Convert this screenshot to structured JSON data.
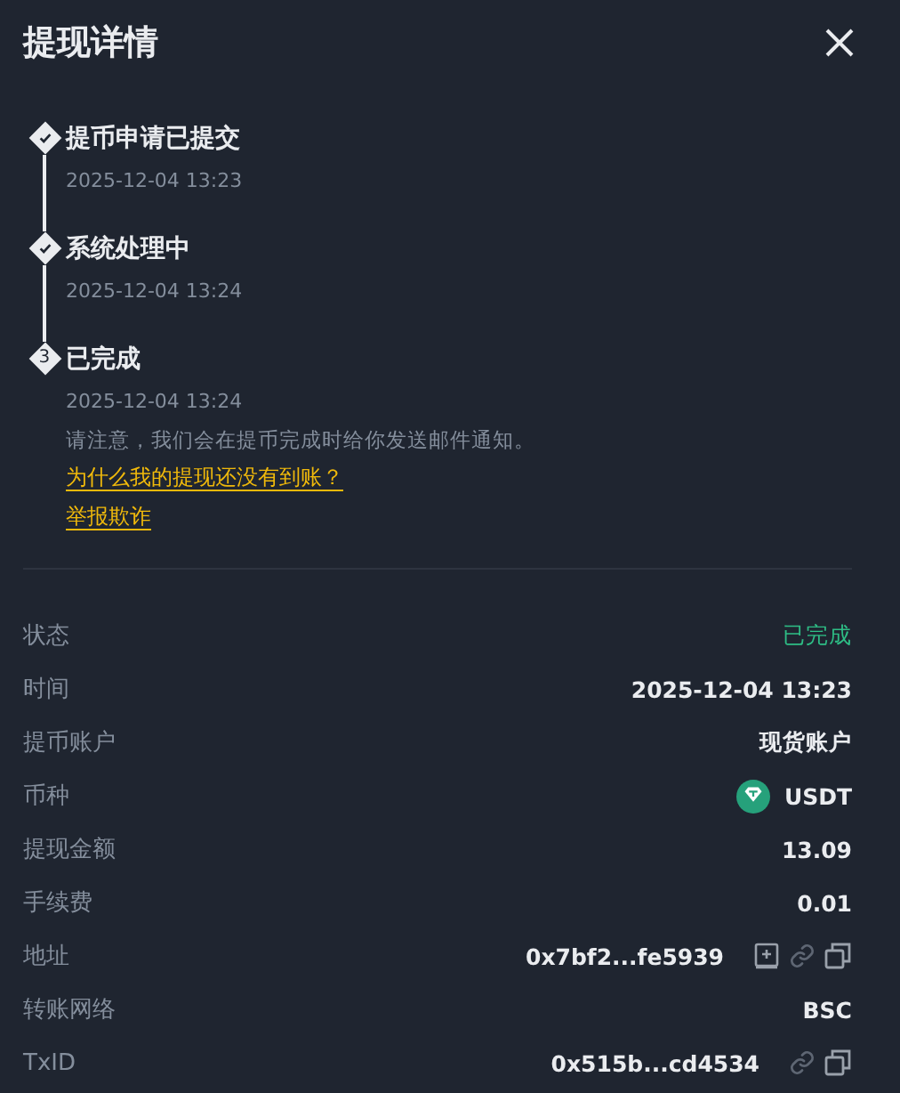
{
  "title": "提现详情",
  "steps": [
    {
      "title": "提币申请已提交",
      "time": "2025-12-04 13:23",
      "done": true
    },
    {
      "title": "系统处理中",
      "time": "2025-12-04 13:24",
      "done": true
    },
    {
      "title": "已完成",
      "time": "2025-12-04 13:24",
      "done": false,
      "marker": "3",
      "note": "请注意，我们会在提币完成时给你发送邮件通知。",
      "links": [
        "为什么我的提现还没有到账？",
        "举报欺诈"
      ]
    }
  ],
  "details": [
    {
      "label": "状态",
      "value": "已完成",
      "kind": "status"
    },
    {
      "label": "时间",
      "value": "2025-12-04 13:23",
      "kind": "text"
    },
    {
      "label": "提币账户",
      "value": "现货账户",
      "kind": "text"
    },
    {
      "label": "币种",
      "value": "USDT",
      "kind": "coin"
    },
    {
      "label": "提现金额",
      "value": "13.09",
      "kind": "text"
    },
    {
      "label": "手续费",
      "value": "0.01",
      "kind": "text"
    },
    {
      "label": "地址",
      "value": "0x7bf2...fe5939",
      "kind": "text",
      "actions": [
        {
          "kind": "address-book"
        },
        {
          "kind": "link"
        },
        {
          "kind": "copy"
        }
      ]
    },
    {
      "label": "转账网络",
      "value": "BSC",
      "kind": "text"
    },
    {
      "label": "TxID",
      "value": "0x515b...cd4534",
      "kind": "text",
      "actions": [
        {
          "kind": "link"
        },
        {
          "kind": "copy"
        }
      ]
    }
  ]
}
